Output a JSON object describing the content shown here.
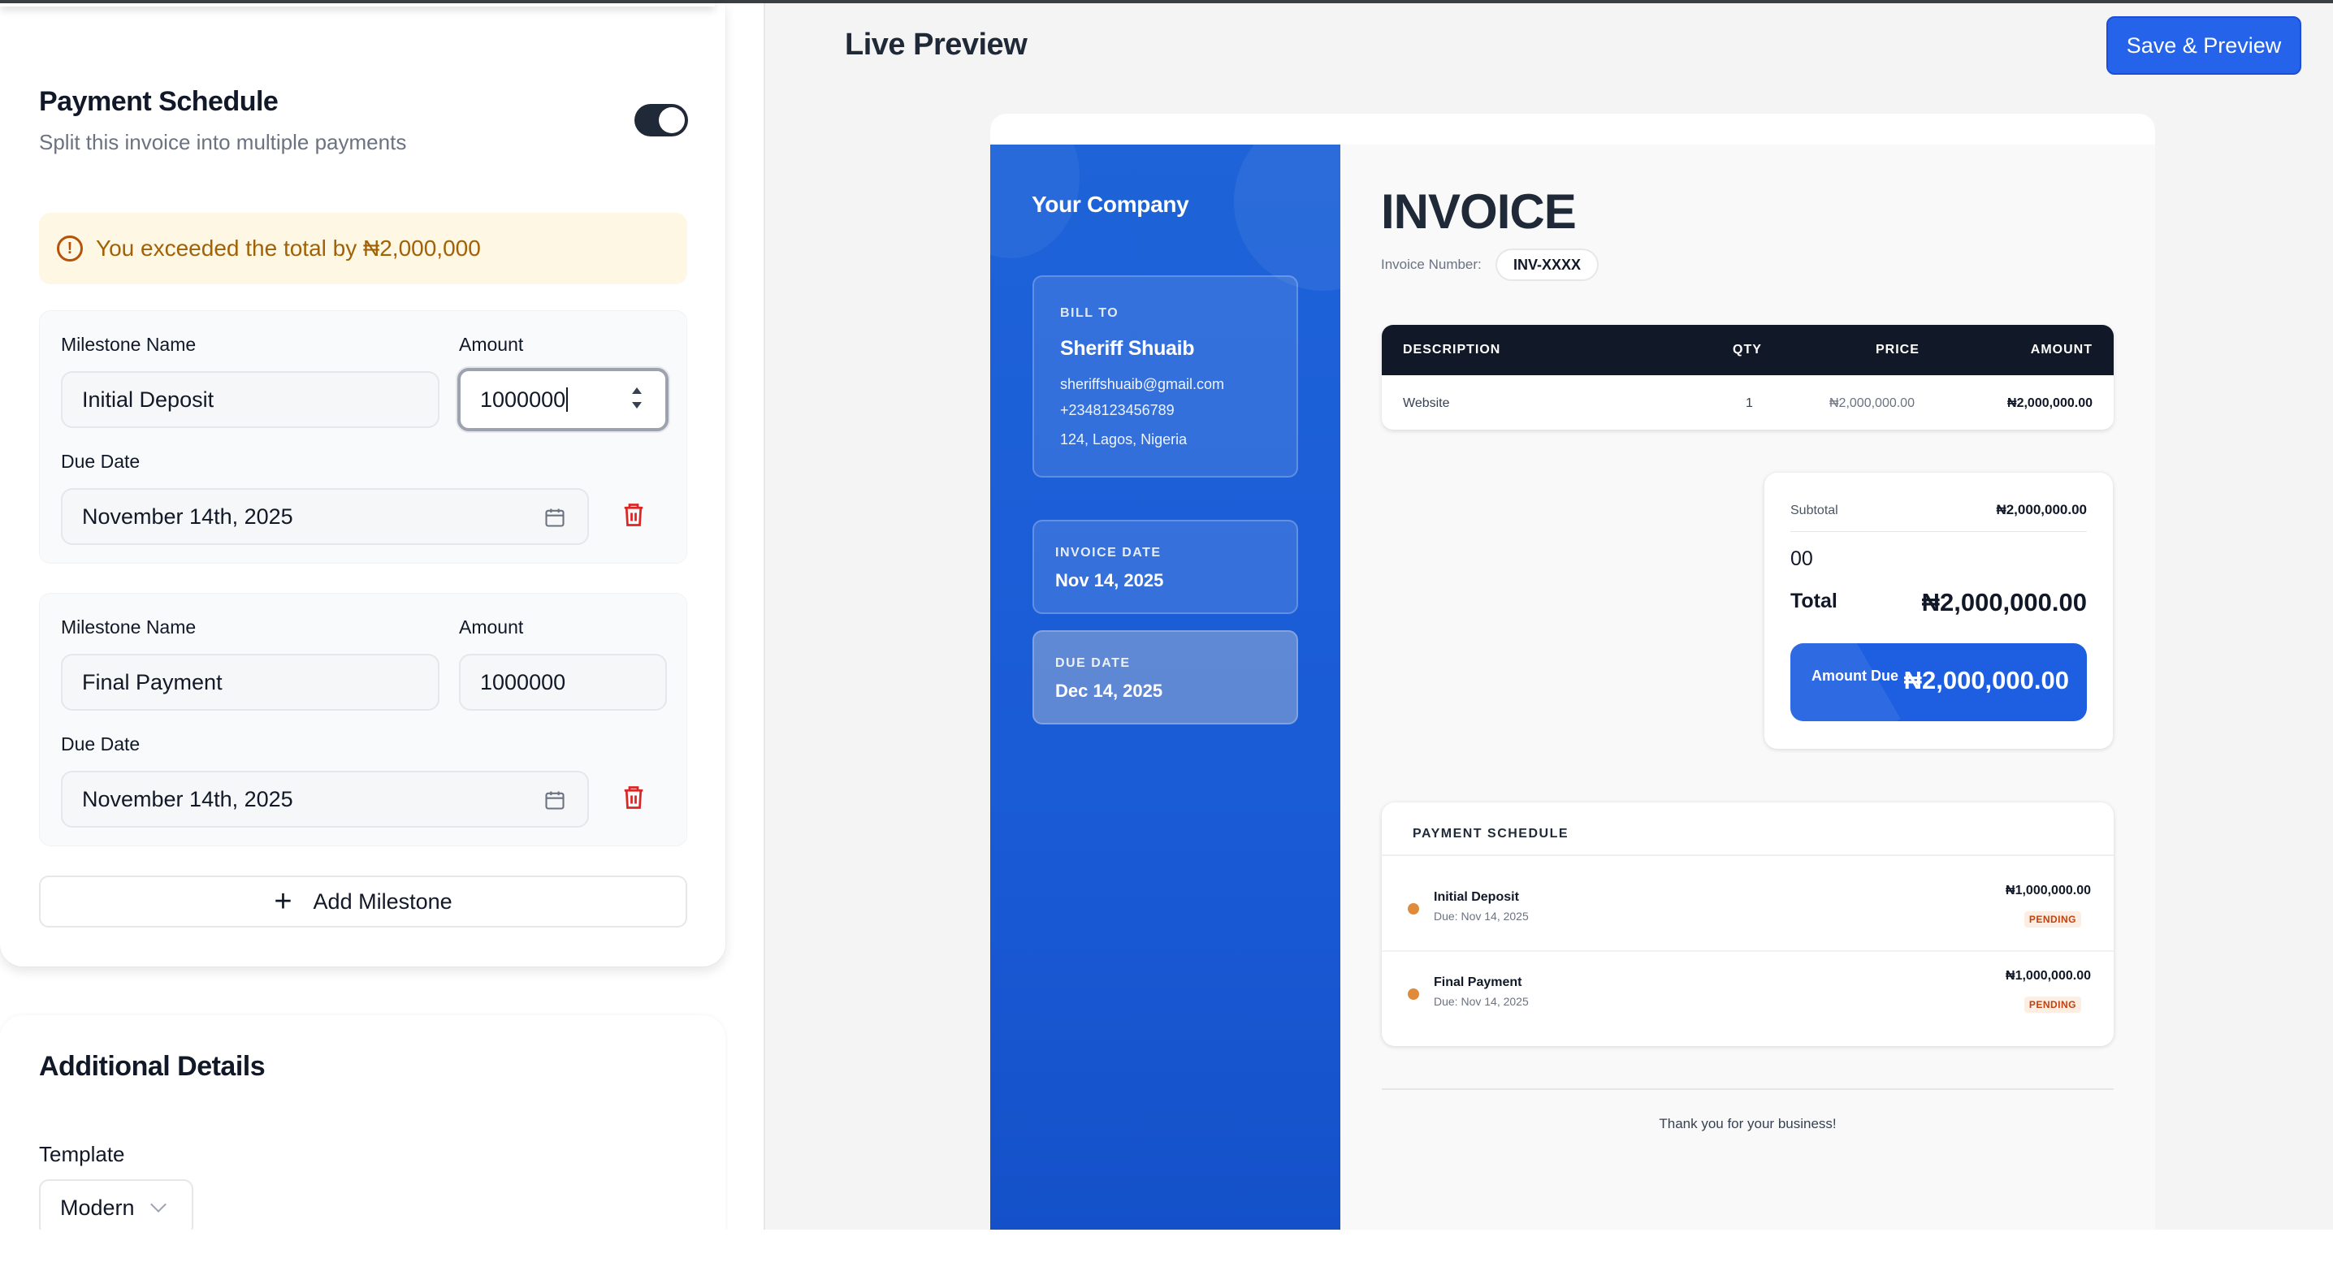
{
  "payment_schedule": {
    "title": "Payment Schedule",
    "subtitle": "Split this invoice into multiple payments",
    "toggle_on": true,
    "warning": "You exceeded the total by ₦2,000,000",
    "milestones": [
      {
        "name_label": "Milestone Name",
        "name": "Initial Deposit",
        "amount_label": "Amount",
        "amount": "1000000",
        "due_label": "Due Date",
        "due": "November 14th, 2025"
      },
      {
        "name_label": "Milestone Name",
        "name": "Final Payment",
        "amount_label": "Amount",
        "amount": "1000000",
        "due_label": "Due Date",
        "due": "November 14th, 2025"
      }
    ],
    "add_label": "Add Milestone"
  },
  "additional_details": {
    "title": "Additional Details",
    "template_label": "Template",
    "template_value": "Modern"
  },
  "preview": {
    "title": "Live Preview",
    "save_label": "Save & Preview"
  },
  "invoice": {
    "company": "Your Company",
    "bill_to_label": "BILL TO",
    "client_name": "Sheriff Shuaib",
    "client_email": "sheriffshuaib@gmail.com",
    "client_phone": "+2348123456789",
    "client_address": "124, Lagos, Nigeria",
    "invoice_date_label": "INVOICE DATE",
    "invoice_date": "Nov 14, 2025",
    "due_date_label": "DUE DATE",
    "due_date": "Dec 14, 2025",
    "heading": "INVOICE",
    "number_label": "Invoice Number:",
    "number": "INV-XXXX",
    "columns": [
      "DESCRIPTION",
      "QTY",
      "PRICE",
      "AMOUNT"
    ],
    "items": [
      {
        "description": "Website",
        "qty": "1",
        "price": "₦2,000,000.00",
        "amount": "₦2,000,000.00"
      }
    ],
    "subtotal_label": "Subtotal",
    "subtotal": "₦2,000,000.00",
    "misc_value": "00",
    "total_label": "Total",
    "total": "₦2,000,000.00",
    "amount_due_label": "Amount Due",
    "amount_due": "₦2,000,000.00",
    "schedule_title": "PAYMENT SCHEDULE",
    "schedule": [
      {
        "name": "Initial Deposit",
        "due": "Due: Nov 14, 2025",
        "amount": "₦1,000,000.00",
        "status": "PENDING"
      },
      {
        "name": "Final Payment",
        "due": "Due: Nov 14, 2025",
        "amount": "₦1,000,000.00",
        "status": "PENDING"
      }
    ],
    "thanks": "Thank you for your business!"
  },
  "colors": {
    "accent": "#2563eb",
    "invoice_sidebar": "#1e63d8",
    "warning_bg": "#fdf7e3",
    "warning_text": "#a16207",
    "delete": "#dc2626",
    "pending": "#c2410c"
  }
}
